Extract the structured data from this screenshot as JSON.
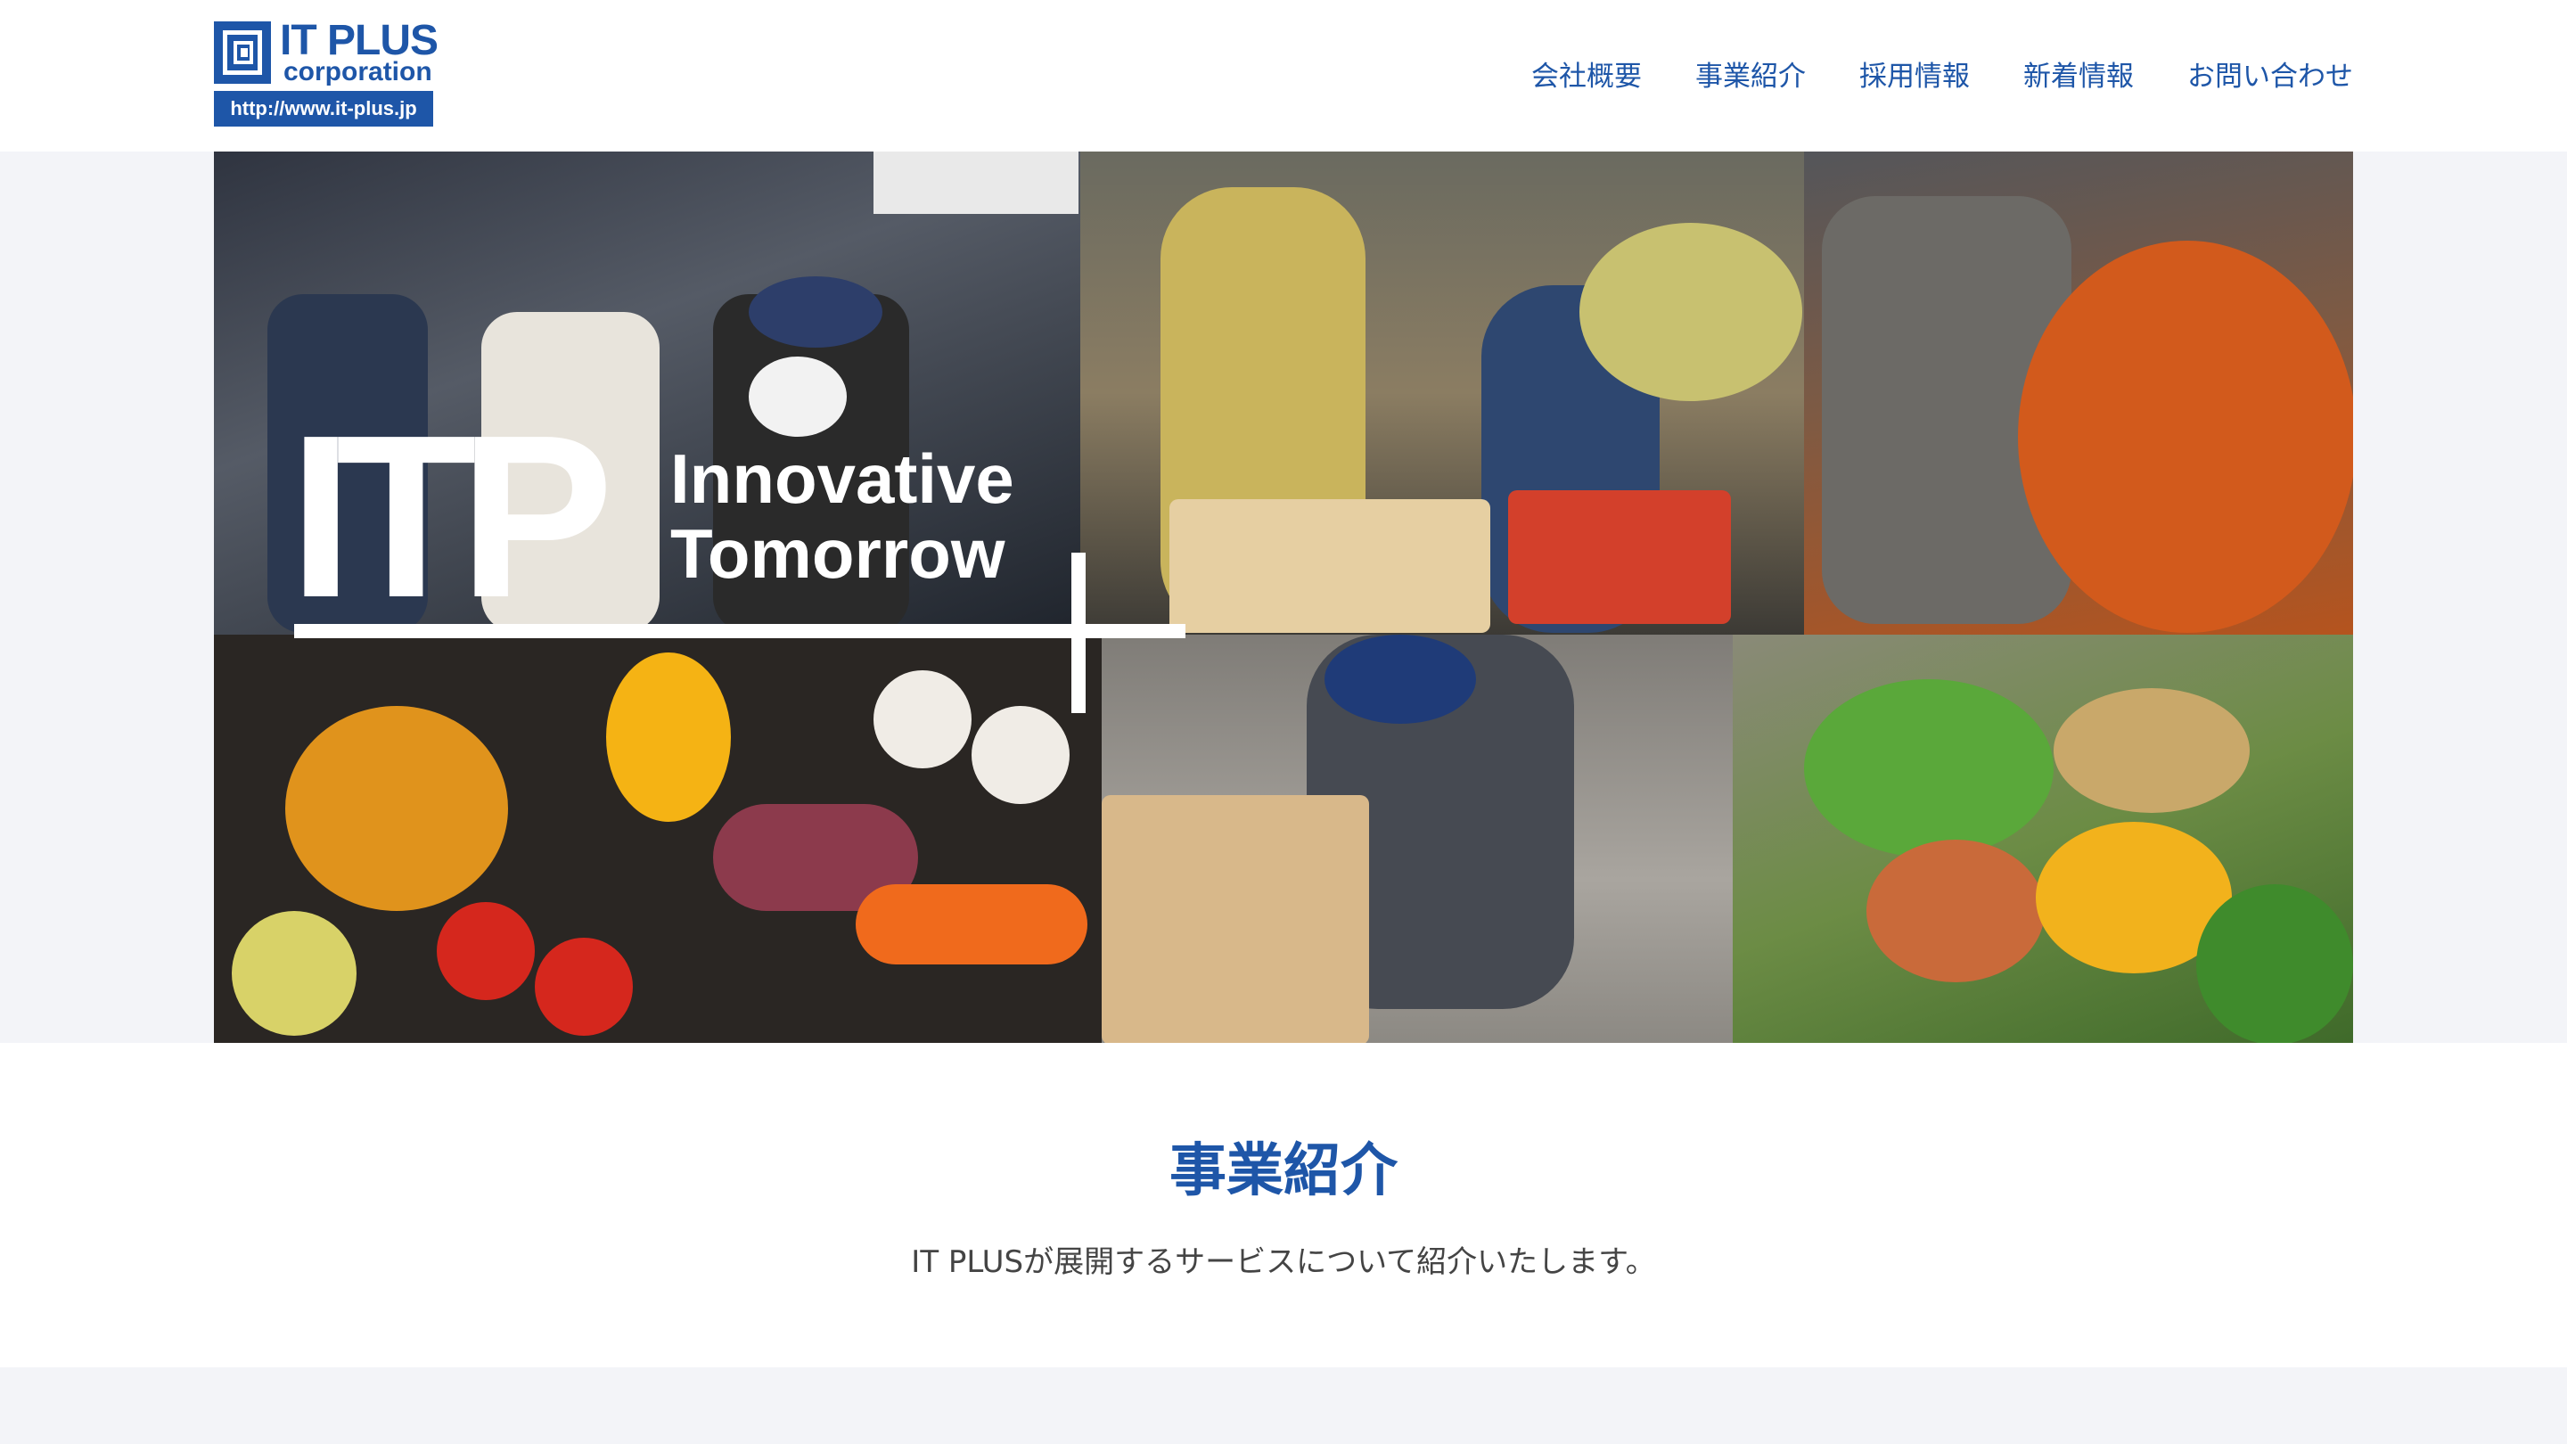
{
  "header": {
    "logo": {
      "name": "IT PLUS",
      "sub": "corporation",
      "url": "http://www.it-plus.jp"
    },
    "nav": [
      {
        "label": "会社概要"
      },
      {
        "label": "事業紹介"
      },
      {
        "label": "採用情報"
      },
      {
        "label": "新着情報"
      },
      {
        "label": "お問い合わせ"
      }
    ]
  },
  "hero": {
    "brand_letters": "ITP",
    "tagline_line1": "Innovative",
    "tagline_line2": "Tomorrow"
  },
  "section": {
    "title": "事業紹介",
    "description": "IT PLUSが展開するサービスについて紹介いたします。"
  },
  "colors": {
    "brand_blue": "#1e56a8",
    "page_bg": "#f3f4f8",
    "text": "#444444"
  }
}
